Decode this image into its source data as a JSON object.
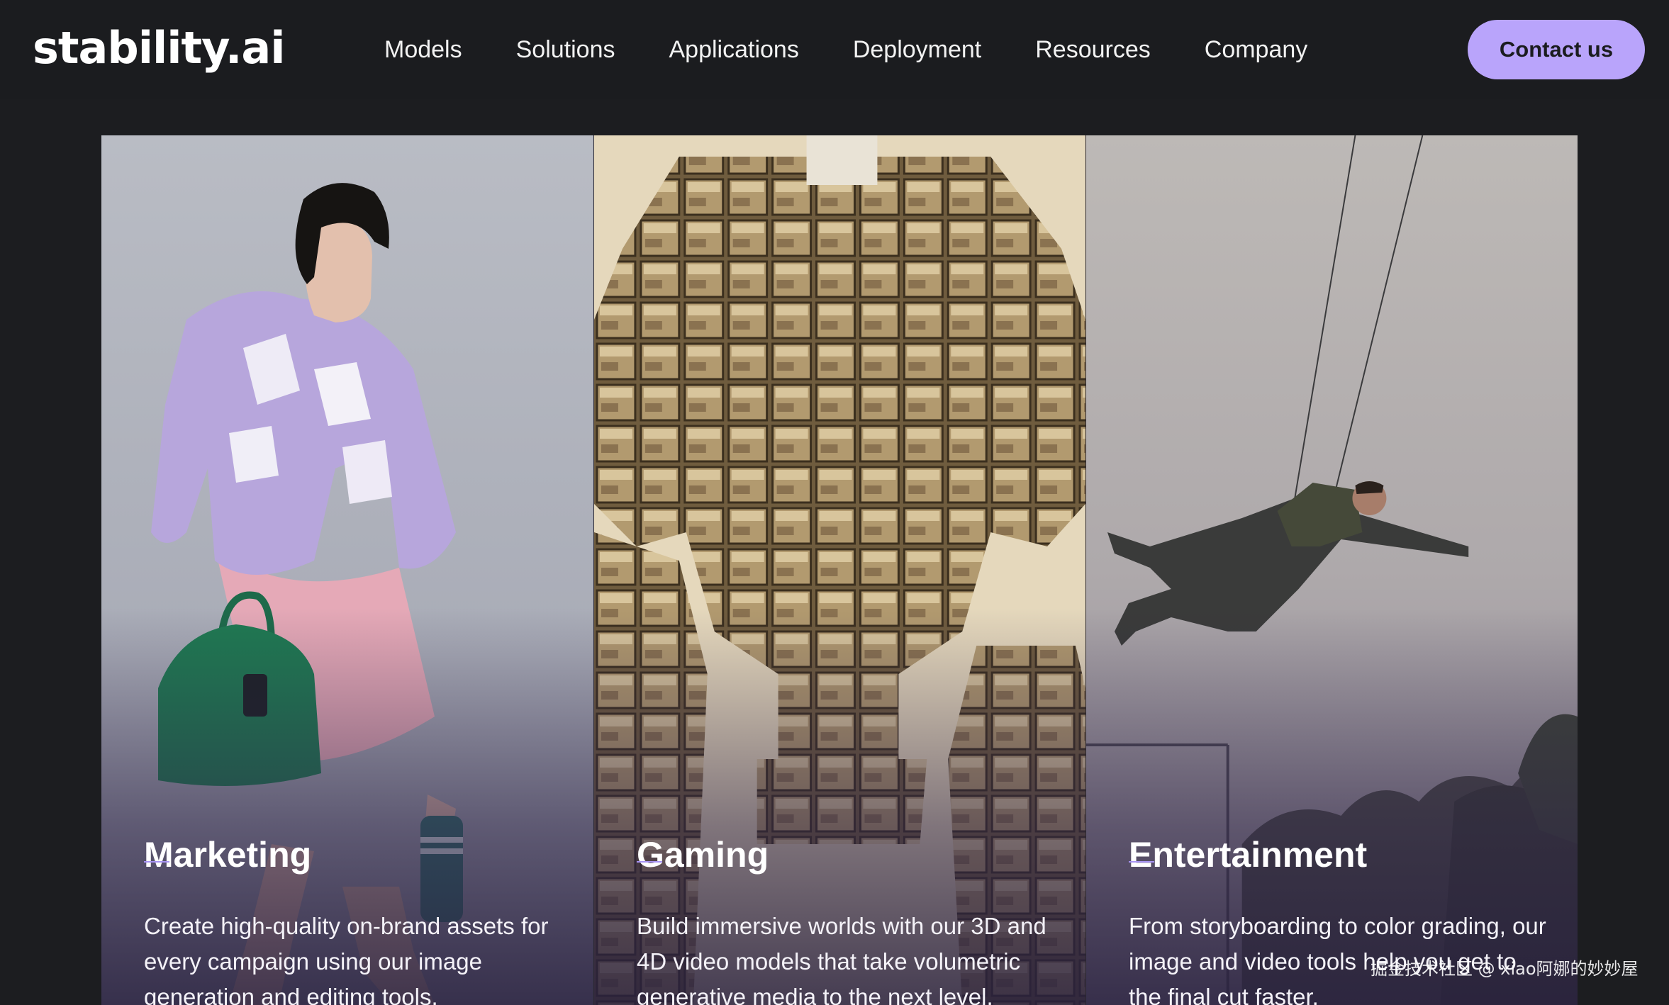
{
  "brand": {
    "logo_text": "stability.ai"
  },
  "nav": {
    "links": [
      "Models",
      "Solutions",
      "Applications",
      "Deployment",
      "Resources",
      "Company"
    ],
    "cta_label": "Contact us"
  },
  "cards": [
    {
      "title": "Marketing",
      "description": "Create high-quality on-brand assets for every campaign using our image generation and editing tools.",
      "image_subject": "fashion-model-photo"
    },
    {
      "title": "Gaming",
      "description": "Build immersive worlds with our 3D and 4D video models that take volumetric generative media to the next level.",
      "image_subject": "block-robot-sketch"
    },
    {
      "title": "Entertainment",
      "description": "From storyboarding to color grading, our image and video tools help you get to the final cut faster.",
      "image_subject": "stunt-flying-man-photo"
    }
  ],
  "colors": {
    "page_bg": "#1c1d20",
    "cta_bg": "#b9a4fb",
    "accent_rule": "#a894f4"
  },
  "watermark": "掘金技术社区 @ xiao阿娜的妙妙屋"
}
